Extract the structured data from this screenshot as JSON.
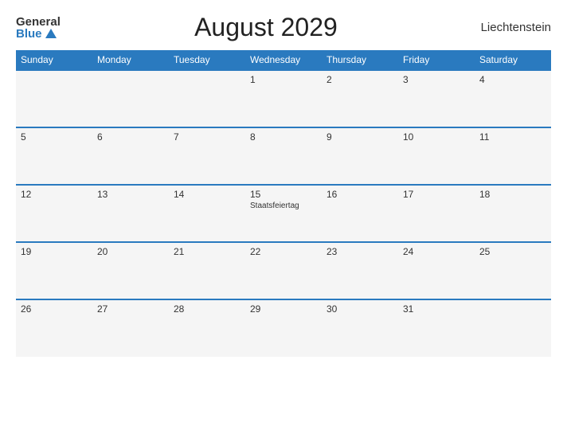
{
  "header": {
    "logo_general": "General",
    "logo_blue": "Blue",
    "title": "August 2029",
    "country": "Liechtenstein"
  },
  "calendar": {
    "weekdays": [
      "Sunday",
      "Monday",
      "Tuesday",
      "Wednesday",
      "Thursday",
      "Friday",
      "Saturday"
    ],
    "weeks": [
      [
        {
          "day": "",
          "event": ""
        },
        {
          "day": "",
          "event": ""
        },
        {
          "day": "",
          "event": ""
        },
        {
          "day": "1",
          "event": ""
        },
        {
          "day": "2",
          "event": ""
        },
        {
          "day": "3",
          "event": ""
        },
        {
          "day": "4",
          "event": ""
        }
      ],
      [
        {
          "day": "5",
          "event": ""
        },
        {
          "day": "6",
          "event": ""
        },
        {
          "day": "7",
          "event": ""
        },
        {
          "day": "8",
          "event": ""
        },
        {
          "day": "9",
          "event": ""
        },
        {
          "day": "10",
          "event": ""
        },
        {
          "day": "11",
          "event": ""
        }
      ],
      [
        {
          "day": "12",
          "event": ""
        },
        {
          "day": "13",
          "event": ""
        },
        {
          "day": "14",
          "event": ""
        },
        {
          "day": "15",
          "event": "Staatsfeiertag"
        },
        {
          "day": "16",
          "event": ""
        },
        {
          "day": "17",
          "event": ""
        },
        {
          "day": "18",
          "event": ""
        }
      ],
      [
        {
          "day": "19",
          "event": ""
        },
        {
          "day": "20",
          "event": ""
        },
        {
          "day": "21",
          "event": ""
        },
        {
          "day": "22",
          "event": ""
        },
        {
          "day": "23",
          "event": ""
        },
        {
          "day": "24",
          "event": ""
        },
        {
          "day": "25",
          "event": ""
        }
      ],
      [
        {
          "day": "26",
          "event": ""
        },
        {
          "day": "27",
          "event": ""
        },
        {
          "day": "28",
          "event": ""
        },
        {
          "day": "29",
          "event": ""
        },
        {
          "day": "30",
          "event": ""
        },
        {
          "day": "31",
          "event": ""
        },
        {
          "day": "",
          "event": ""
        }
      ]
    ]
  }
}
